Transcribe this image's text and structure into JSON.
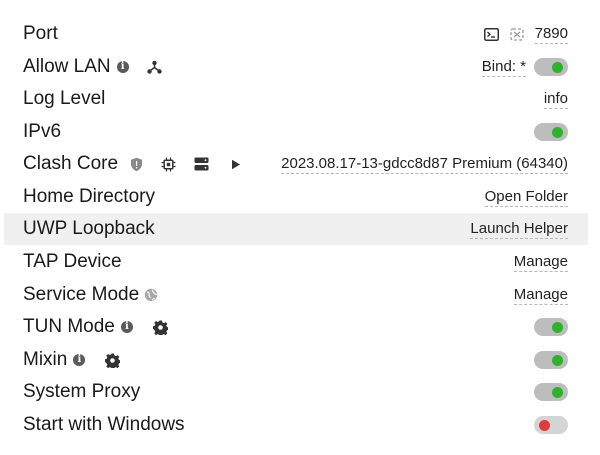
{
  "rows": {
    "port": {
      "label": "Port",
      "value": "7890"
    },
    "allow_lan": {
      "label": "Allow LAN",
      "bind_label": "Bind: *",
      "toggle_on": true
    },
    "log_level": {
      "label": "Log Level",
      "value": "info"
    },
    "ipv6": {
      "label": "IPv6",
      "toggle_on": true
    },
    "clash_core": {
      "label": "Clash Core",
      "value": "2023.08.17-13-gdcc8d87 Premium (64340)"
    },
    "home_directory": {
      "label": "Home Directory",
      "action": "Open Folder"
    },
    "uwp_loopback": {
      "label": "UWP Loopback",
      "action": "Launch Helper"
    },
    "tap_device": {
      "label": "TAP Device",
      "action": "Manage"
    },
    "service_mode": {
      "label": "Service Mode",
      "action": "Manage"
    },
    "tun_mode": {
      "label": "TUN Mode",
      "toggle_on": true
    },
    "mixin": {
      "label": "Mixin",
      "toggle_on": true
    },
    "system_proxy": {
      "label": "System Proxy",
      "toggle_on": true
    },
    "start_with_windows": {
      "label": "Start with Windows",
      "toggle_on": false
    }
  },
  "colors": {
    "toggle_on_dot": "#2fb12f",
    "toggle_off_dot": "#e03b3b",
    "toggle_track": "#bdbdbd",
    "highlight_row": "#f0f0f0"
  },
  "icons": {
    "info": "info-icon",
    "network": "network-icon",
    "terminal": "terminal-icon",
    "random_port": "shuffle-icon",
    "shield": "shield-icon",
    "cpu": "cpu-icon",
    "server": "server-icon",
    "play": "play-icon",
    "globe": "globe-icon",
    "gear": "gear-icon"
  }
}
